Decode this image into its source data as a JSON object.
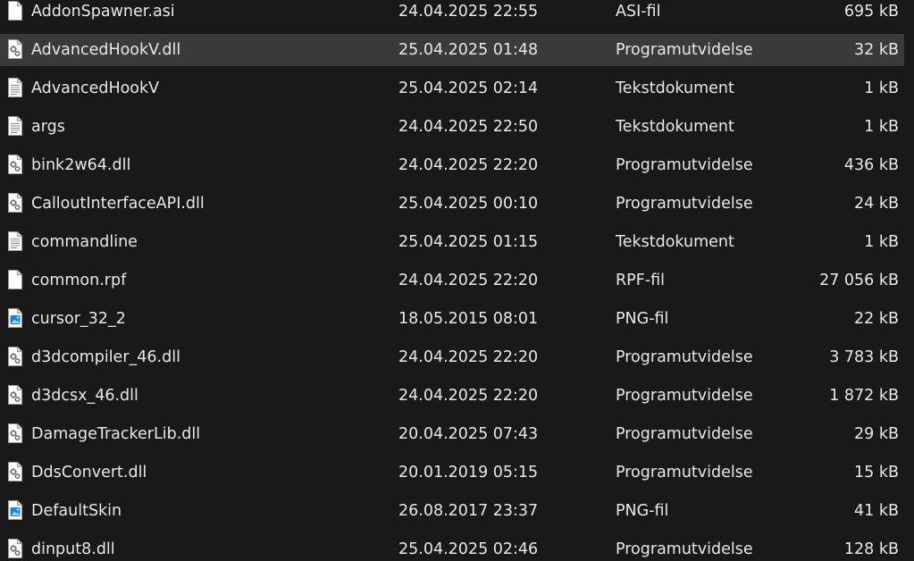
{
  "files": [
    {
      "name": "AddonSpawner.asi",
      "modified": "24.04.2025 22:55",
      "type": "ASI-fil",
      "size": "695 kB",
      "icon": "generic-file-icon",
      "selected": false
    },
    {
      "name": "AdvancedHookV.dll",
      "modified": "25.04.2025 01:48",
      "type": "Programutvidelse",
      "size": "32 kB",
      "icon": "dll-file-icon",
      "selected": true
    },
    {
      "name": "AdvancedHookV",
      "modified": "25.04.2025 02:14",
      "type": "Tekstdokument",
      "size": "1 kB",
      "icon": "text-file-icon",
      "selected": false
    },
    {
      "name": "args",
      "modified": "24.04.2025 22:50",
      "type": "Tekstdokument",
      "size": "1 kB",
      "icon": "text-file-icon",
      "selected": false
    },
    {
      "name": "bink2w64.dll",
      "modified": "24.04.2025 22:20",
      "type": "Programutvidelse",
      "size": "436 kB",
      "icon": "dll-file-icon",
      "selected": false
    },
    {
      "name": "CalloutInterfaceAPI.dll",
      "modified": "25.04.2025 00:10",
      "type": "Programutvidelse",
      "size": "24 kB",
      "icon": "dll-file-icon",
      "selected": false
    },
    {
      "name": "commandline",
      "modified": "25.04.2025 01:15",
      "type": "Tekstdokument",
      "size": "1 kB",
      "icon": "text-file-icon",
      "selected": false
    },
    {
      "name": "common.rpf",
      "modified": "24.04.2025 22:20",
      "type": "RPF-fil",
      "size": "27 056 kB",
      "icon": "generic-file-icon",
      "selected": false
    },
    {
      "name": "cursor_32_2",
      "modified": "18.05.2015 08:01",
      "type": "PNG-fil",
      "size": "22 kB",
      "icon": "image-file-icon",
      "selected": false
    },
    {
      "name": "d3dcompiler_46.dll",
      "modified": "24.04.2025 22:20",
      "type": "Programutvidelse",
      "size": "3 783 kB",
      "icon": "dll-file-icon",
      "selected": false
    },
    {
      "name": "d3dcsx_46.dll",
      "modified": "24.04.2025 22:20",
      "type": "Programutvidelse",
      "size": "1 872 kB",
      "icon": "dll-file-icon",
      "selected": false
    },
    {
      "name": "DamageTrackerLib.dll",
      "modified": "20.04.2025 07:43",
      "type": "Programutvidelse",
      "size": "29 kB",
      "icon": "dll-file-icon",
      "selected": false
    },
    {
      "name": "DdsConvert.dll",
      "modified": "20.01.2019 05:15",
      "type": "Programutvidelse",
      "size": "15 kB",
      "icon": "dll-file-icon",
      "selected": false
    },
    {
      "name": "DefaultSkin",
      "modified": "26.08.2017 23:37",
      "type": "PNG-fil",
      "size": "41 kB",
      "icon": "image-file-icon",
      "selected": false
    },
    {
      "name": "dinput8.dll",
      "modified": "25.04.2025 02:46",
      "type": "Programutvidelse",
      "size": "128 kB",
      "icon": "dll-file-icon",
      "selected": false
    }
  ],
  "colors": {
    "background": "#191919",
    "selected_row": "#3a3a3a",
    "text": "#e8e8e8"
  }
}
